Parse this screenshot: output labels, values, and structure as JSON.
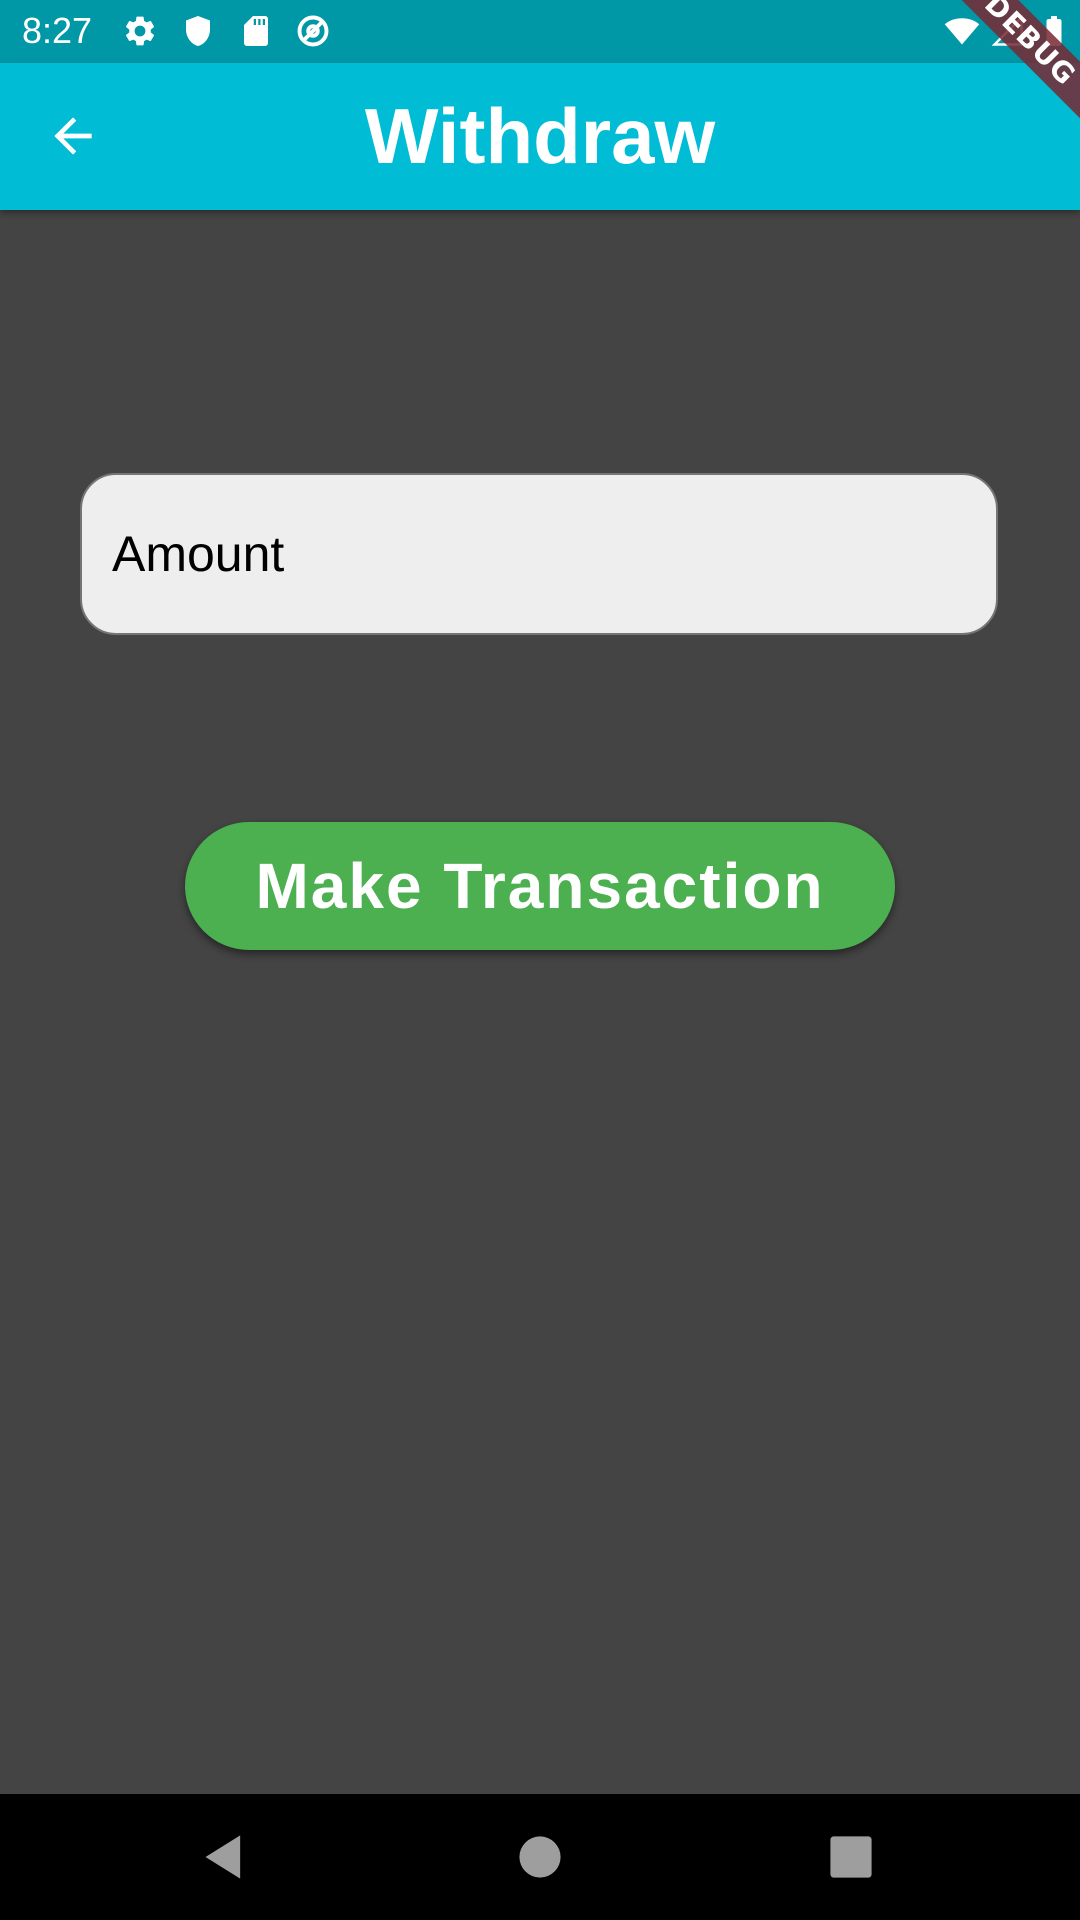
{
  "status_bar": {
    "time": "8:27",
    "left_icons": [
      "settings-gear-icon",
      "shield-icon",
      "sd-card-icon",
      "at-sign-icon"
    ],
    "right_icons": [
      "wifi-icon",
      "cell-signal-icon",
      "battery-icon"
    ],
    "background_color": "#0097a7"
  },
  "app_bar": {
    "title": "Withdraw",
    "back_icon": "arrow-back-icon",
    "background_color": "#00bcd4"
  },
  "debug_banner": {
    "label": "DEBUG"
  },
  "form": {
    "amount_placeholder": "Amount",
    "amount_value": "",
    "submit_label": "Make Transaction",
    "submit_color": "#4caf50"
  },
  "nav_bar": {
    "buttons": [
      "back-triangle-icon",
      "home-circle-icon",
      "recents-square-icon"
    ]
  },
  "colors": {
    "page_background": "#444444",
    "field_background": "#eeeeee"
  }
}
